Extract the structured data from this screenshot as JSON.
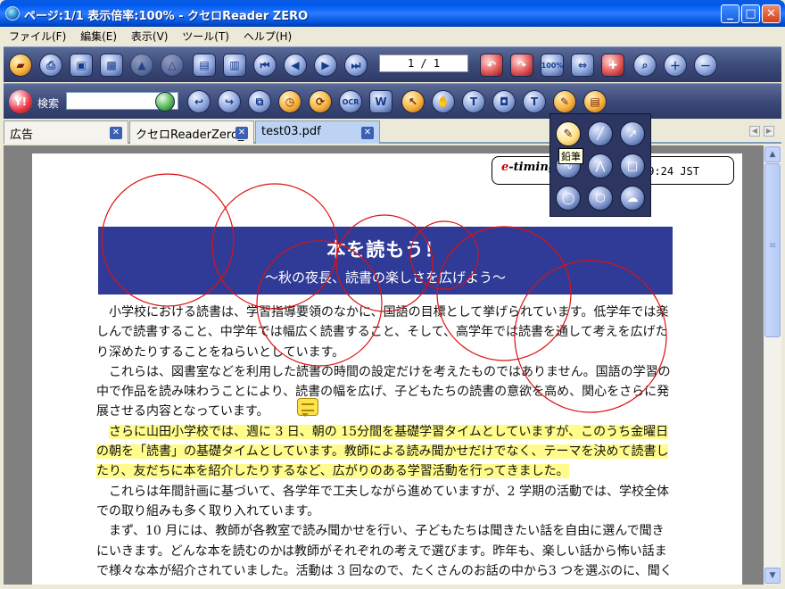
{
  "window": {
    "title": "ページ:1/1  表示倍率:100% - クセロReader ZERO",
    "minimize": "_",
    "maximize": "□",
    "close": "✕"
  },
  "menu": [
    {
      "label": "ファイル(F)"
    },
    {
      "label": "編集(E)"
    },
    {
      "label": "表示(V)"
    },
    {
      "label": "ツール(T)"
    },
    {
      "label": "ヘルプ(H)"
    }
  ],
  "toolbar1": {
    "page_field": "1 / 1",
    "zoom_icon_label": "100%"
  },
  "toolbar2": {
    "search_label": "検索",
    "search_value": "",
    "ocr_label": "OCR"
  },
  "tabs": [
    {
      "label": "広告",
      "close": "✕"
    },
    {
      "label": "クセロReaderZero_l",
      "close": "✕"
    },
    {
      "label": "test03.pdf",
      "close": "✕"
    }
  ],
  "palette": {
    "tooltip": "鉛筆"
  },
  "document": {
    "stamp": {
      "brand_e": "e",
      "brand_rest": "-timing",
      "time": "9:24 JST"
    },
    "banner_title": "本を読もう！",
    "banner_subtitle": "～秋の夜長、読書の楽しさを広げよう～",
    "p1": "小学校における読書は、学習指導要領のなかに、国語の目標として挙げられています。低学年では楽しんで読書すること、中学年では幅広く読書すること、そして、高学年では読書を通して考えを広げたり深めたりすることをねらいとしています。",
    "p2": "これらは、図書室などを利用した読書の時間の設定だけを考えたものではありません。国語の学習の中で作品を読み味わうことにより、読書の幅を広げ、子どもたちの読書の意欲を高め、関心をさらに発展させる内容となっています。",
    "p3": "さらに山田小学校では、週に 3 日、朝の 15分間を基礎学習タイムとしていますが、このうち金曜日の朝を「読書」の基礎タイムとしています。教師による読み聞かせだけでなく、テーマを決めて読書したり、友だちに本を紹介したりするなど、広がりのある学習活動を行ってきました。",
    "p4": "これらは年間計画に基づいて、各学年で工夫しながら進めていますが、2 学期の活動では、学校全体での取り組みも多く取り入れています。",
    "p5": "まず、10 月には、教師が各教室で読み聞かせを行い、子どもたちは聞きたい話を自由に選んで聞きにいきます。どんな本を読むのかは教師がそれぞれの考えで選びます。昨年も、楽しい話から怖い話まで様々な本が紹介されていました。活動は 3 回なので、たくさんのお話の中から3 つを選ぶのに、聞く"
  },
  "colors": {
    "banner": "#2f3b96",
    "highlight": "#fffc8c",
    "annotation": "#dd1111",
    "toolbar": "#3d4b7a"
  }
}
